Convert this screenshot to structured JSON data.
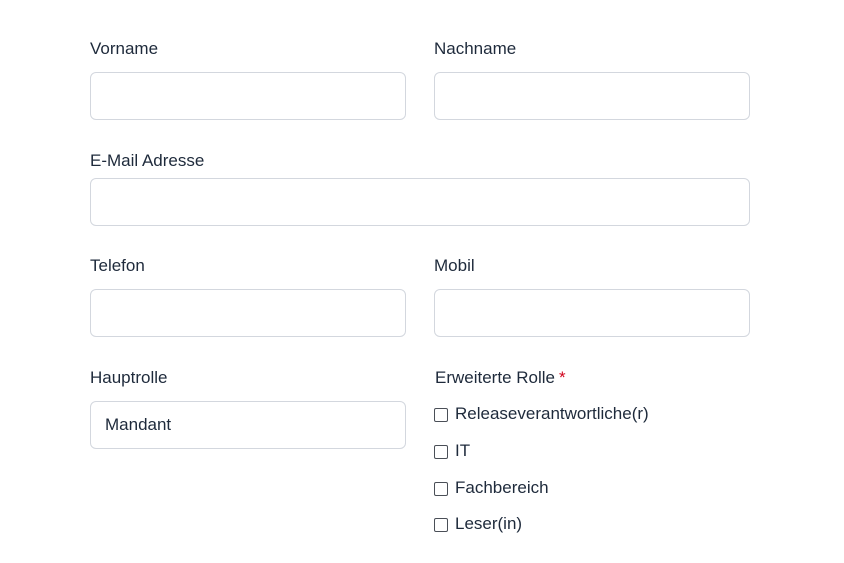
{
  "form": {
    "first_name": {
      "label": "Vorname",
      "value": ""
    },
    "last_name": {
      "label": "Nachname",
      "value": ""
    },
    "email": {
      "label": "E-Mail Adresse",
      "value": ""
    },
    "phone": {
      "label": "Telefon",
      "value": ""
    },
    "mobile": {
      "label": "Mobil",
      "value": ""
    },
    "main_role": {
      "label": "Hauptrolle",
      "value": "Mandant"
    },
    "extended_role": {
      "label": "Erweiterte Rolle",
      "required_marker": "*",
      "options": [
        {
          "label": "Releaseverantwortliche(r)",
          "checked": false
        },
        {
          "label": "IT",
          "checked": false
        },
        {
          "label": "Fachbereich",
          "checked": false
        },
        {
          "label": "Leser(in)",
          "checked": false
        }
      ]
    }
  },
  "colors": {
    "text": "#1e2a3b",
    "border": "#d3d7de",
    "required": "#d0021b"
  }
}
